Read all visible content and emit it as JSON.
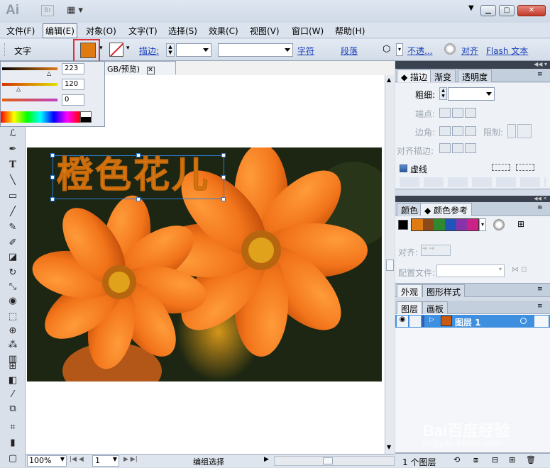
{
  "app": {
    "logo": "Ai",
    "bridge_label": "Br"
  },
  "menu": [
    "文件(F)",
    "编辑(E)",
    "对象(O)",
    "文字(T)",
    "选择(S)",
    "效果(C)",
    "视图(V)",
    "窗口(W)",
    "帮助(H)"
  ],
  "control": {
    "type_label": "文字",
    "fill_color": "#e07b12",
    "stroke_label": "描边:",
    "char_link": "字符",
    "para_link": "段落",
    "opacity_link": "不透...",
    "align_link": "对齐",
    "flash_link": "Flash 文本"
  },
  "color_popup": {
    "r": "223",
    "g": "120",
    "b": "0",
    "r_level": 0.87,
    "g_level": 0.47,
    "b_level": 0.0
  },
  "document": {
    "tab_label": "GB/预览)",
    "headline_text": "橙色花儿",
    "headline_color": "#e07b12"
  },
  "status": {
    "zoom": "100%",
    "page": "1",
    "mode": "编组选择"
  },
  "stroke_panel": {
    "tabs": [
      "描边",
      "渐变",
      "透明度"
    ],
    "weight_label": "粗细:",
    "cap_label": "端点:",
    "corner_label": "边角:",
    "limit_label": "限制:",
    "align_label": "对齐描边:",
    "dashed_label": "虚线"
  },
  "color_panel": {
    "tabs": [
      "颜色",
      "颜色参考"
    ],
    "swatches": [
      "#e07b12",
      "#8a4a1a",
      "#2f8a2f",
      "#2255bb",
      "#8833aa",
      "#cc2288"
    ],
    "align_label": "对齐:",
    "profile_label": "配置文件:"
  },
  "appearance_panel": {
    "tabs": [
      "外观",
      "图形样式"
    ]
  },
  "layers_panel": {
    "tabs": [
      "图层",
      "画板"
    ],
    "layer_name": "图层 1",
    "count_label": "1 个图层"
  },
  "watermark": {
    "text": "Bai百度经验",
    "url": "jingyan.baidu.com"
  }
}
